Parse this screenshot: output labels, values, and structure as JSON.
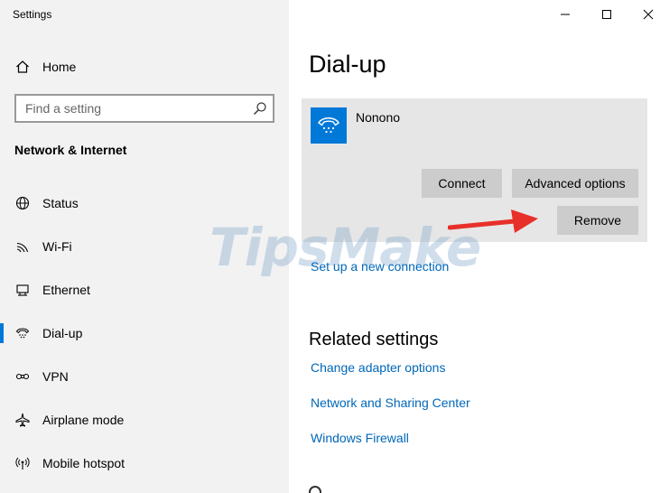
{
  "window": {
    "title": "Settings"
  },
  "sidebar": {
    "home_label": "Home",
    "search_placeholder": "Find a setting",
    "section_title": "Network & Internet",
    "items": [
      {
        "label": "Status",
        "icon": "globe-icon"
      },
      {
        "label": "Wi-Fi",
        "icon": "wifi-icon"
      },
      {
        "label": "Ethernet",
        "icon": "ethernet-icon"
      },
      {
        "label": "Dial-up",
        "icon": "phone-icon",
        "active": true
      },
      {
        "label": "VPN",
        "icon": "vpn-icon"
      },
      {
        "label": "Airplane mode",
        "icon": "airplane-icon"
      },
      {
        "label": "Mobile hotspot",
        "icon": "hotspot-icon"
      }
    ]
  },
  "main": {
    "title": "Dial-up",
    "connection": {
      "name": "Nonono",
      "connect_label": "Connect",
      "advanced_label": "Advanced options",
      "remove_label": "Remove"
    },
    "setup_link": "Set up a new connection",
    "related_title": "Related settings",
    "related_links": [
      "Change adapter options",
      "Network and Sharing Center",
      "Windows Firewall"
    ]
  },
  "watermark": "TipsMake",
  "colors": {
    "accent": "#0078d7",
    "link": "#0067b8",
    "sidebar_bg": "#f2f2f2",
    "card_bg": "#e6e6e6",
    "button_bg": "#cccccc",
    "arrow": "#e8302a"
  }
}
